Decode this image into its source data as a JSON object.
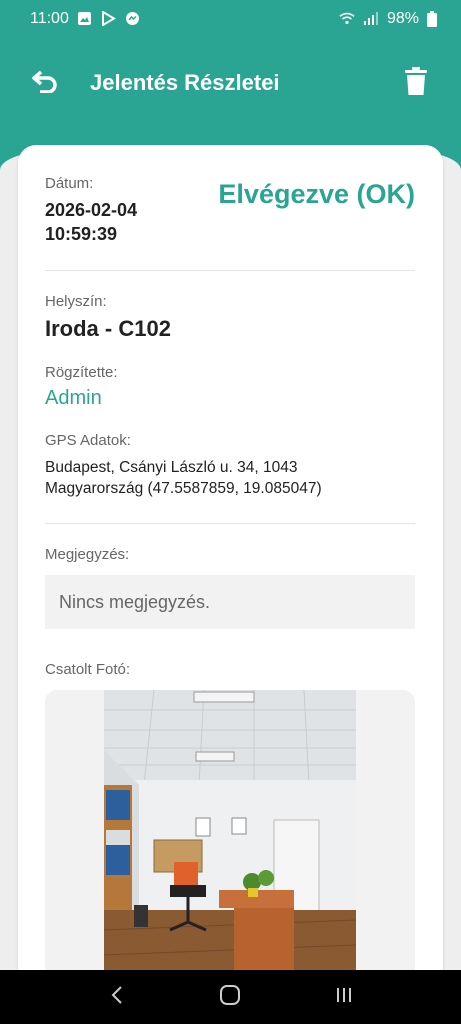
{
  "status_bar": {
    "time": "11:00",
    "battery": "98%"
  },
  "app_bar": {
    "title": "Jelentés Részletei"
  },
  "report": {
    "date_label": "Dátum:",
    "date_value": "2026-02-04",
    "time_value": "10:59:39",
    "status": "Elvégezve (OK)",
    "location_label": "Helyszín:",
    "location_value": "Iroda - C102",
    "recorded_by_label": "Rögzítette:",
    "recorded_by_value": "Admin",
    "gps_label": "GPS Adatok:",
    "gps_line1": "Budapest, Csányi László u. 34, 1043",
    "gps_line2": "Magyarország (47.5587859, 19.085047)",
    "note_label": "Megjegyzés:",
    "note_value": "Nincs megjegyzés.",
    "photo_label": "Csatolt Fotó:"
  },
  "colors": {
    "accent": "#2aa594",
    "background": "#eeeeee",
    "card": "#ffffff"
  },
  "icons": {
    "back": "undo-arrow-icon",
    "delete": "trash-icon",
    "nav_back": "chevron-left-icon",
    "nav_home": "home-circle-icon",
    "nav_recents": "recents-icon"
  }
}
